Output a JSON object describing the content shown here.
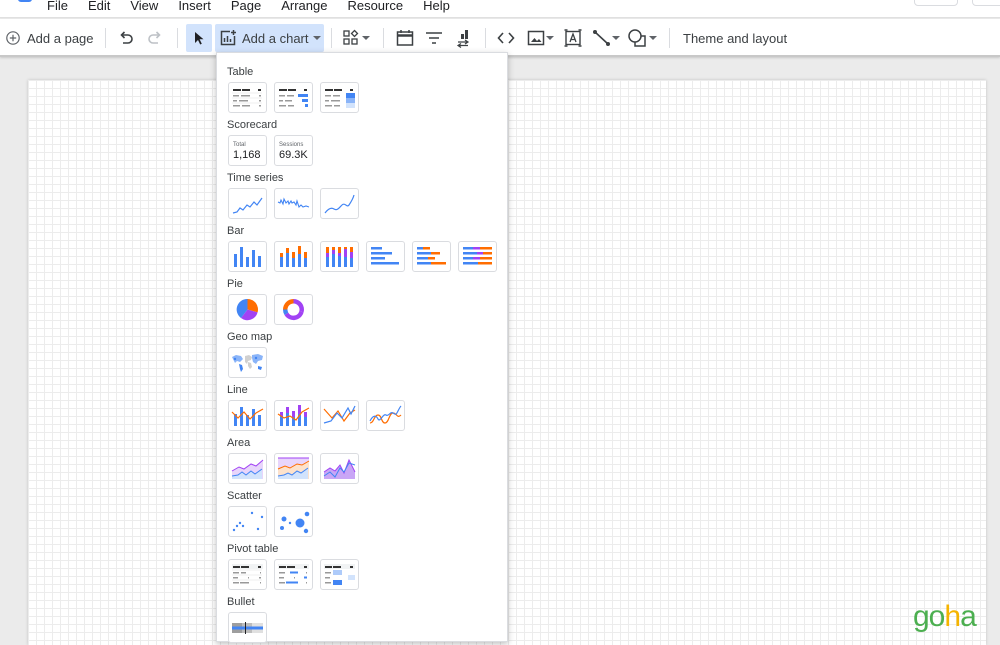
{
  "menubar": {
    "items": [
      "File",
      "Edit",
      "View",
      "Insert",
      "Page",
      "Arrange",
      "Resource",
      "Help"
    ]
  },
  "toolbar": {
    "add_page_label": "Add a page",
    "add_chart_label": "Add a chart",
    "theme_label": "Theme and layout",
    "icons": [
      "add-circle-icon",
      "undo-icon",
      "redo-icon",
      "select-pointer-icon",
      "add-chart-icon",
      "controls-icon",
      "date-range-icon",
      "filter-icon",
      "data-control-icon",
      "embed-code-icon",
      "image-icon",
      "text-box-icon",
      "line-icon",
      "shape-icon"
    ]
  },
  "chart_menu": {
    "sections": [
      {
        "title": "Table",
        "items": [
          "table",
          "table-with-bars",
          "table-with-heatmap"
        ]
      },
      {
        "title": "Scorecard",
        "items": [
          {
            "label": "Total",
            "value": "1,168"
          },
          {
            "label": "Sessions",
            "value": "69.3K"
          }
        ]
      },
      {
        "title": "Time series",
        "items": [
          "time-series",
          "sparkline",
          "smoothed-time-series"
        ]
      },
      {
        "title": "Bar",
        "items": [
          "column",
          "stacked-column",
          "100-stacked-column",
          "bar",
          "stacked-bar",
          "100-stacked-bar"
        ]
      },
      {
        "title": "Pie",
        "items": [
          "pie",
          "donut"
        ]
      },
      {
        "title": "Geo map",
        "items": [
          "geo-map"
        ]
      },
      {
        "title": "Line",
        "items": [
          "combo",
          "stacked-combo",
          "line",
          "smoothed-line"
        ]
      },
      {
        "title": "Area",
        "items": [
          "area",
          "stacked-area",
          "100-stacked-area"
        ]
      },
      {
        "title": "Scatter",
        "items": [
          "scatter",
          "bubble"
        ]
      },
      {
        "title": "Pivot table",
        "items": [
          "pivot-table",
          "pivot-with-bars",
          "pivot-with-heatmap"
        ]
      },
      {
        "title": "Bullet",
        "items": [
          "bullet"
        ]
      }
    ]
  },
  "colors": {
    "blue": "#4285f4",
    "orange": "#ff6d00",
    "purple": "#a142f4",
    "selected_bg": "#d2e3fc"
  },
  "watermark": {
    "text_a": "go",
    "text_h": "h",
    "text_b": "a"
  }
}
